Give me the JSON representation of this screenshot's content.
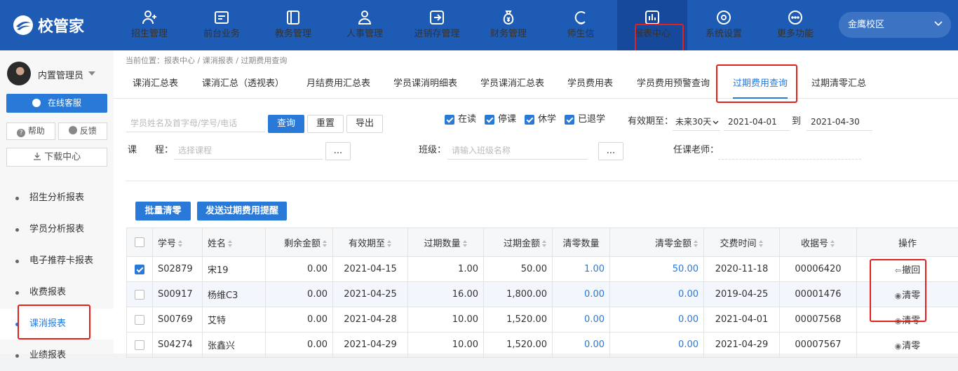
{
  "brand": {
    "name": "校管家"
  },
  "top_nav": [
    {
      "label": "招生管理",
      "icon": "user-add-icon"
    },
    {
      "label": "前台业务",
      "icon": "desk-icon"
    },
    {
      "label": "教务管理",
      "icon": "book-icon"
    },
    {
      "label": "人事管理",
      "icon": "person-icon"
    },
    {
      "label": "进销存管理",
      "icon": "inventory-icon"
    },
    {
      "label": "财务管理",
      "icon": "money-bag-icon"
    },
    {
      "label": "师生信",
      "icon": "chat-icon"
    },
    {
      "label": "报表中心",
      "icon": "report-chart-icon"
    },
    {
      "label": "系统设置",
      "icon": "settings-icon"
    },
    {
      "label": "更多功能",
      "icon": "more-icon"
    }
  ],
  "campus": {
    "label": "金鹰校区"
  },
  "user": {
    "name": "内置管理员"
  },
  "sidebar": {
    "service_label": "在线客服",
    "help_label": "帮助",
    "feedback_label": "反馈",
    "download_label": "下载中心",
    "items": [
      {
        "label": "招生分析报表"
      },
      {
        "label": "学员分析报表"
      },
      {
        "label": "电子推荐卡报表"
      },
      {
        "label": "收费报表"
      },
      {
        "label": "课消报表"
      },
      {
        "label": "业绩报表"
      }
    ]
  },
  "breadcrumb": "当前位置：报表中心 / 课消报表 / 过期费用查询",
  "tabs": [
    {
      "label": "课消汇总表"
    },
    {
      "label": "课消汇总（透视表）"
    },
    {
      "label": "月结费用汇总表"
    },
    {
      "label": "学员课消明细表"
    },
    {
      "label": "学员课消汇总表"
    },
    {
      "label": "学员费用表"
    },
    {
      "label": "学员费用预警查询"
    },
    {
      "label": "过期费用查询"
    },
    {
      "label": "过期清零汇总"
    }
  ],
  "filters": {
    "search_placeholder": "学员姓名及首字母/学号/电话",
    "query_label": "查询",
    "reset_label": "重置",
    "export_label": "导出",
    "status": [
      {
        "label": "在读",
        "checked": true
      },
      {
        "label": "停课",
        "checked": true
      },
      {
        "label": "休学",
        "checked": true
      },
      {
        "label": "已退学",
        "checked": true
      }
    ],
    "validity_label": "有效期至：",
    "validity_select": "未来30天",
    "date_from": "2021-04-01",
    "to_label": "到",
    "date_to": "2021-04-30",
    "course_label": "课　　程：",
    "course_placeholder": "选择课程",
    "ellipsis": "...",
    "class_label": "班级：",
    "class_placeholder": "请输入班级名称",
    "teacher_label": "任课老师："
  },
  "actions": {
    "batch_clear": "批量清零",
    "send_reminder": "发送过期费用提醒"
  },
  "table": {
    "headers": [
      "学号",
      "姓名",
      "剩余金额",
      "有效期至",
      "过期数量",
      "过期金额",
      "清零数量",
      "清零金额",
      "交费时间",
      "收据号",
      "操作"
    ],
    "rows": [
      {
        "checked": true,
        "id": "S02879",
        "name": "宋19",
        "remaining": "0.00",
        "expiry": "2021-04-15",
        "expired_qty": "1.00",
        "expired_amount": "50.00",
        "cleared_qty": "1.00",
        "cleared_amount": "50.00",
        "paid_at": "2020-11-18",
        "receipt": "00006420",
        "op": "撤回",
        "op_icon": "undo-icon"
      },
      {
        "checked": false,
        "id": "S00917",
        "name": "杨维C3",
        "remaining": "0.00",
        "expiry": "2021-04-25",
        "expired_qty": "16.00",
        "expired_amount": "1,800.00",
        "cleared_qty": "0.00",
        "cleared_amount": "0.00",
        "paid_at": "2019-04-25",
        "receipt": "00001476",
        "op": "清零",
        "op_icon": "clear-icon"
      },
      {
        "checked": false,
        "id": "S00769",
        "name": "艾特",
        "remaining": "0.00",
        "expiry": "2021-04-28",
        "expired_qty": "10.00",
        "expired_amount": "1,520.00",
        "cleared_qty": "0.00",
        "cleared_amount": "0.00",
        "paid_at": "2021-04-01",
        "receipt": "00007568",
        "op": "清零",
        "op_icon": "clear-icon"
      },
      {
        "checked": false,
        "id": "S04274",
        "name": "张鑫兴",
        "remaining": "0.00",
        "expiry": "2021-04-29",
        "expired_qty": "10.00",
        "expired_amount": "1,520.00",
        "cleared_qty": "0.00",
        "cleared_amount": "0.00",
        "paid_at": "2021-04-29",
        "receipt": "00007567",
        "op": "清零",
        "op_icon": "clear-icon"
      }
    ]
  },
  "colors": {
    "header_bg": "#1d5bb5",
    "accent": "#2979d9",
    "highlight": "#e5201c"
  }
}
